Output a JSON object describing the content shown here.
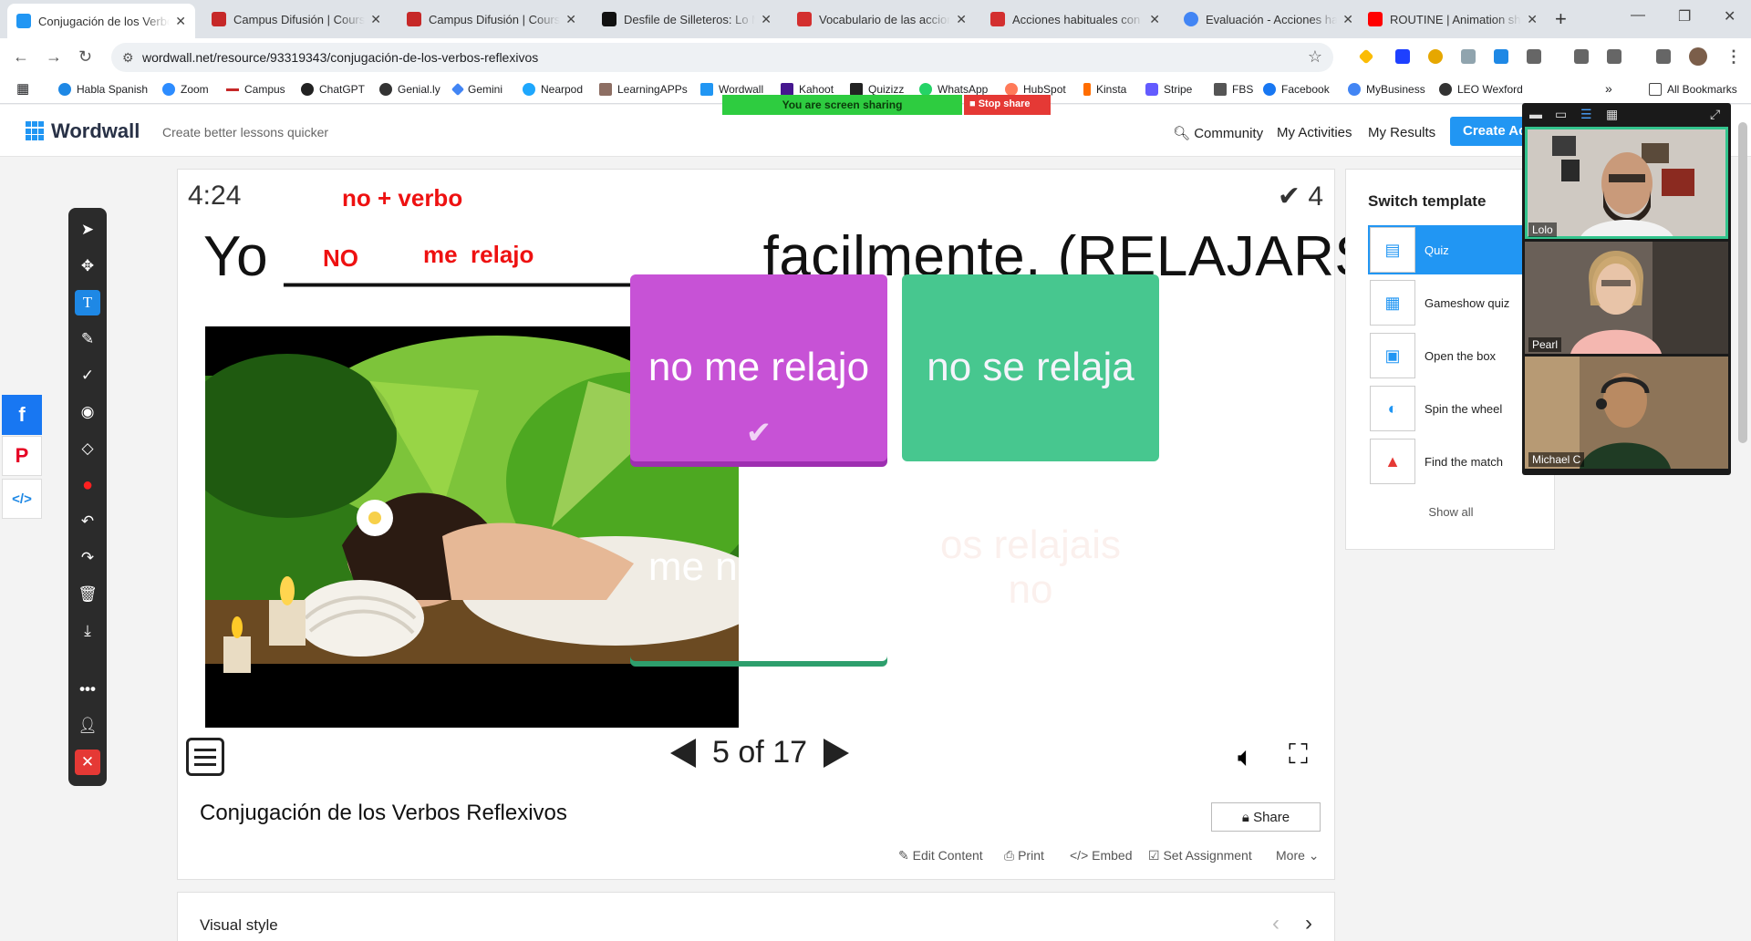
{
  "browser": {
    "tabs": [
      {
        "title": "Conjugación de los Verbos",
        "color": "#2196f3",
        "active": true
      },
      {
        "title": "Campus Difusión | Courses",
        "color": "#c62828"
      },
      {
        "title": "Campus Difusión | Courses",
        "color": "#c62828"
      },
      {
        "title": "Desfile de Silleteros: Lo M",
        "color": "#111111"
      },
      {
        "title": "Vocabulario de las acciones",
        "color": "#d32f2f"
      },
      {
        "title": "Acciones habituales con M",
        "color": "#d32f2f"
      },
      {
        "title": "Evaluación - Acciones hab",
        "color": "#4285f4"
      },
      {
        "title": "ROUTINE | Animation shor",
        "color": "#ff0000"
      }
    ],
    "url": "wordwall.net/resource/93319343/conjugación-de-los-verbos-reflexivos",
    "bookmarks": [
      {
        "label": "Habla Spanish",
        "color": "#1e88e5"
      },
      {
        "label": "Zoom",
        "color": "#2d8cff"
      },
      {
        "label": "Campus",
        "color": "#c62828"
      },
      {
        "label": "ChatGPT",
        "color": "#222222"
      },
      {
        "label": "Genial.ly",
        "color": "#333333"
      },
      {
        "label": "Gemini",
        "color": "#4285f4"
      },
      {
        "label": "Nearpod",
        "color": "#1ea7fd"
      },
      {
        "label": "LearningAPPs",
        "color": "#8d6e63"
      },
      {
        "label": "Wordwall",
        "color": "#2196f3"
      },
      {
        "label": "Kahoot",
        "color": "#46178f"
      },
      {
        "label": "Quizizz",
        "color": "#222222"
      },
      {
        "label": "WhatsApp",
        "color": "#25d366"
      },
      {
        "label": "HubSpot",
        "color": "#ff7a59"
      },
      {
        "label": "Kinsta",
        "color": "#ff6d00"
      },
      {
        "label": "Stripe",
        "color": "#635bff"
      },
      {
        "label": "FBS",
        "color": "#555555"
      },
      {
        "label": "Facebook",
        "color": "#1877f2"
      },
      {
        "label": "MyBusiness",
        "color": "#4285f4"
      },
      {
        "label": "LEO Wexford",
        "color": "#333333"
      }
    ],
    "all_bookmarks": "All Bookmarks"
  },
  "screen_share": {
    "banner": "You are screen sharing",
    "stop": "Stop share"
  },
  "wordwall": {
    "logo": "Wordwall",
    "tagline": "Create better lessons quicker",
    "nav": {
      "community": "Community",
      "activities": "My Activities",
      "results": "My Results",
      "create": "Create Ac"
    }
  },
  "quiz": {
    "timer": "4:24",
    "score": "4",
    "question": "Yo _______________facilmente. (RELAJARSE)",
    "annotations": {
      "rule": "no + verbo",
      "no": "NO",
      "answer": "me  relajo"
    },
    "answers": [
      {
        "text": "no me relajo",
        "mark": "✔",
        "color": "#c752d6"
      },
      {
        "text": "no se relaja",
        "mark": "",
        "color": "#d2d4f0"
      },
      {
        "text": "me no relajo",
        "mark": "✖",
        "color": "#47c78f"
      },
      {
        "text": "os relajais no",
        "mark": "",
        "color": "#f6d4cd"
      }
    ],
    "pager": {
      "current": "5",
      "of_label": "of",
      "total": "17"
    }
  },
  "activity": {
    "title": "Conjugación de los Verbos Reflexivos",
    "share": "Share",
    "actions": {
      "edit": "Edit Content",
      "print": "Print",
      "embed": "Embed",
      "assign": "Set Assignment",
      "more": "More"
    },
    "visual_style": "Visual style"
  },
  "templates": {
    "heading": "Switch template",
    "items": [
      "Quiz",
      "Gameshow quiz",
      "Open the box",
      "Spin the wheel",
      "Find the match"
    ],
    "show_all": "Show all"
  },
  "call": {
    "participants": [
      {
        "name": "Lolo"
      },
      {
        "name": "Pearl"
      },
      {
        "name": "Michael C"
      }
    ]
  }
}
